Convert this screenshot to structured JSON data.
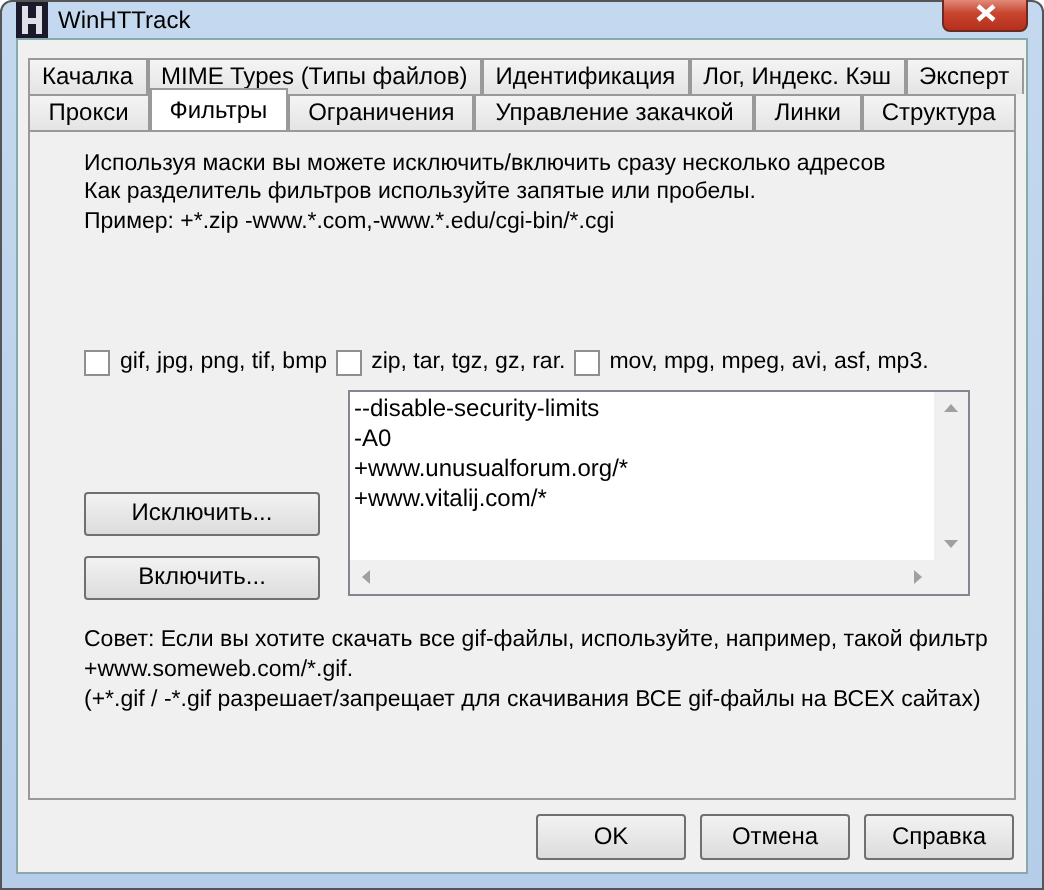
{
  "window": {
    "title": "WinHTTrack"
  },
  "tab_rows": [
    [
      {
        "label": "Качалка",
        "selected": false
      },
      {
        "label": "MIME Types (Типы файлов)",
        "selected": false
      },
      {
        "label": "Идентификация",
        "selected": false
      },
      {
        "label": "Лог, Индекс. Кэш",
        "selected": false
      },
      {
        "label": "Эксперт",
        "selected": false
      }
    ],
    [
      {
        "label": "Прокси",
        "selected": false
      },
      {
        "label": "Фильтры",
        "selected": true
      },
      {
        "label": "Ограничения",
        "selected": false
      },
      {
        "label": "Управление закачкой",
        "selected": false
      },
      {
        "label": "Линки",
        "selected": false
      },
      {
        "label": "Структура",
        "selected": false
      }
    ]
  ],
  "intro": [
    "Используя маски вы можете исключить/включить сразу несколько адресов",
    "Как разделитель фильтров используйте запятые или пробелы.",
    "Пример: +*.zip -www.*.com,-www.*.edu/cgi-bin/*.cgi"
  ],
  "checkboxes": [
    {
      "label": "gif, jpg, png, tif, bmp",
      "checked": false
    },
    {
      "label": "zip, tar, tgz, gz, rar.",
      "checked": false
    },
    {
      "label": "mov, mpg, mpeg, avi, asf, mp3.",
      "checked": false
    }
  ],
  "filter_buttons": [
    "Исключить...",
    "Включить..."
  ],
  "filters": [
    "--disable-security-limits",
    "-A0",
    "+www.unusualforum.org/*",
    "+www.vitalij.com/*"
  ],
  "tip": [
    "Совет: Если вы хотите скачать все gif-файлы, используйте, например, такой фильтр",
    "+www.someweb.com/*.gif.",
    "(+*.gif / -*.gif разрешает/запрещает для скачивания ВСЕ gif-файлы на ВСЕХ сайтах)"
  ],
  "dialog_buttons": [
    "OK",
    "Отмена",
    "Справка"
  ]
}
